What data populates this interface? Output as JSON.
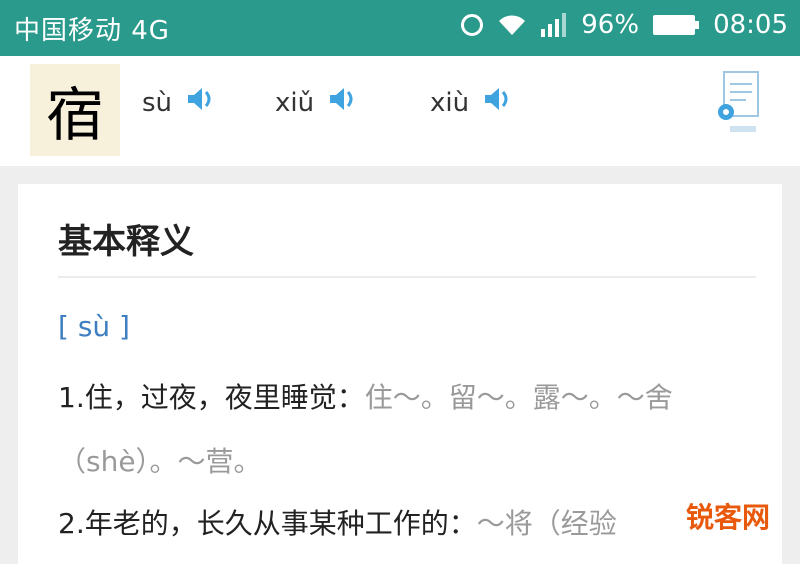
{
  "status_bar": {
    "carrier": "中国移动 4G",
    "battery_percent": "96%",
    "time": "08:05",
    "icons": [
      "alarm-icon",
      "wifi-icon",
      "signal-icon",
      "battery-icon"
    ]
  },
  "header": {
    "character": "宿",
    "pronunciations": [
      {
        "pinyin": "sù",
        "icon": "speaker-icon"
      },
      {
        "pinyin": "xiǔ",
        "icon": "speaker-icon"
      },
      {
        "pinyin": "xiù",
        "icon": "speaker-icon"
      }
    ],
    "action_icon": "document-gear-icon"
  },
  "card": {
    "title": "基本释义",
    "pinyin_label": "[ sù ]",
    "definitions": [
      {
        "main": "1.住，过夜，夜里睡觉：",
        "example": "住～。留～。露～。～舍"
      },
      {
        "main": "",
        "example": "（shè）。～营。"
      },
      {
        "main": "2.年老的，长久从事某种工作的：",
        "example": "～将（经验"
      }
    ]
  },
  "watermark": "锐客网",
  "colors": {
    "status_bar": "#2a9a8c",
    "speaker": "#3fa3e0",
    "pinyin": "#3d7fc1",
    "char_bg": "#f7f0da",
    "watermark": "#e8590c"
  }
}
